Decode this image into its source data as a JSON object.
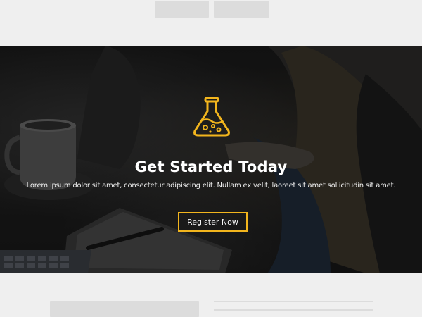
{
  "hero": {
    "title": "Get Started Today",
    "text": "Lorem ipsum dolor sit amet, consectetur adipiscing elit. Nullam ex velit, laoreet sit amet sollicitudin sit amet.",
    "button_label": "Register Now",
    "icon": "flask-icon",
    "accent_color": "#f2b51d"
  }
}
